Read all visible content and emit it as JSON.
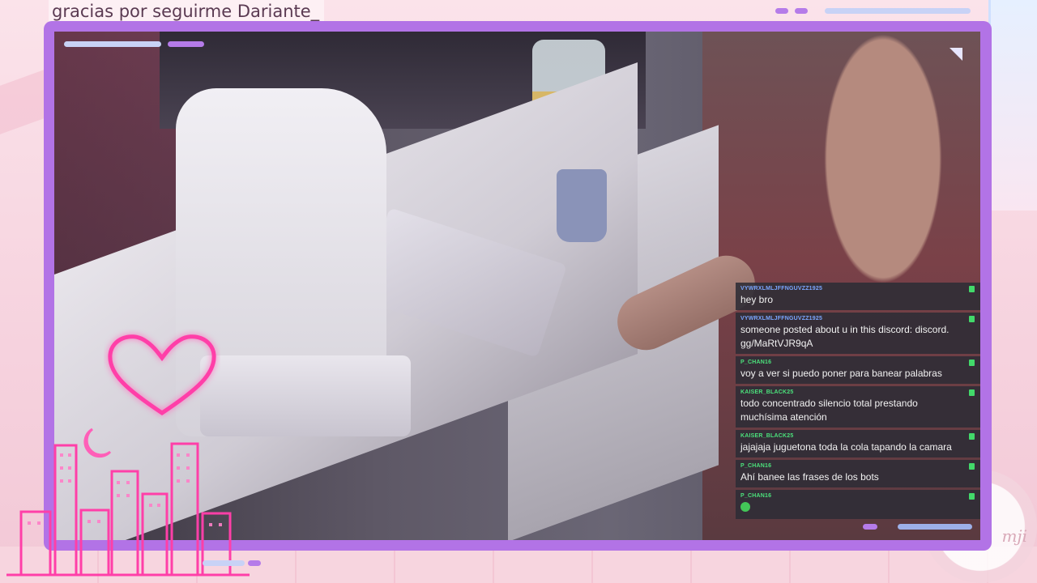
{
  "banner": {
    "follow_text": "gracias por seguirme Dariante_"
  },
  "decor": {
    "lace_text": "mji",
    "colors": {
      "frame": "#b273e6",
      "neon_pink": "#ff3fa8",
      "chat_bg": "#2e2c36",
      "badge": "#42d96a"
    }
  },
  "chat": {
    "messages": [
      {
        "user": "VYWRXLMLJFFNGUVZZ1925",
        "user_color": "#7aa6ff",
        "text": "hey bro"
      },
      {
        "user": "VYWRXLMLJFFNGUVZZ1925",
        "user_color": "#7aa6ff",
        "text": "someone posted about u in this discord: discord. gg/MaRtVJR9qA"
      },
      {
        "user": "P_CHAN16",
        "user_color": "#4be07b",
        "text": "voy a ver si puedo poner para banear palabras"
      },
      {
        "user": "KAISER_BLACK25",
        "user_color": "#4be07b",
        "text": "todo concentrado silencio total prestando muchísima atención"
      },
      {
        "user": "KAISER_BLACK25",
        "user_color": "#4be07b",
        "text": "jajajaja juguetona toda la cola tapando la camara"
      },
      {
        "user": "P_CHAN16",
        "user_color": "#4be07b",
        "text": "Ahí banee las frases de los bots"
      },
      {
        "user": "P_CHAN16",
        "user_color": "#4be07b",
        "text": "",
        "emote": "whatsapp-emote"
      }
    ]
  }
}
